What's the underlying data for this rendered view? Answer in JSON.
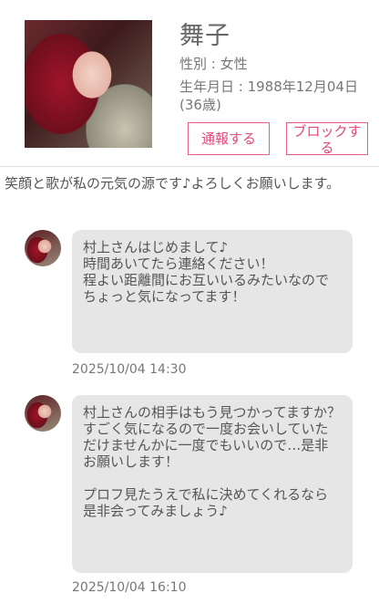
{
  "profile": {
    "name": "舞子",
    "gender": "性別 : 女性",
    "birthday": "生年月日 : 1988年12月04日(36歳)",
    "bio": "笑顔と歌が私の元気の源です♪よろしくお願いします。"
  },
  "actions": {
    "report_label": "通報する",
    "block_label": "ブロックする"
  },
  "messages": [
    {
      "text": "村上さんはじめまして♪\n時間あいてたら連絡ください！\n程よい距離間にお互いいるみたいなのでちょっと気になってます！",
      "timestamp": "2025/10/04 14:30"
    },
    {
      "text": "村上さんの相手はもう見つかってますか？\nすごく気になるので一度お会いしていただけませんかに一度でもいいので…是非お願いします！\n\nプロフ見たうえで私に決めてくれるなら是非会ってみましょう♪",
      "timestamp": "2025/10/04 16:10"
    }
  ],
  "colors": {
    "accent": "#e3477b",
    "bubble": "#e6e6e6"
  }
}
